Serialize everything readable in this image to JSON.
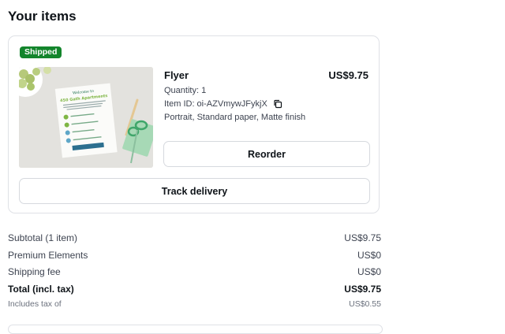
{
  "page": {
    "title": "Your items"
  },
  "order": {
    "status_badge": "Shipped",
    "status_color": "#13852c",
    "product": {
      "name": "Flyer",
      "price": "US$9.75",
      "quantity_text": "Quantity: 1",
      "item_id_text": "Item ID: oi-AZVmywJFykjX",
      "options_text": "Portrait, Standard paper, Matte finish"
    },
    "thumbnail": {
      "flyer_heading": "Welcome to",
      "flyer_title": "450 Gath Apartments"
    },
    "reorder_label": "Reorder",
    "track_label": "Track delivery"
  },
  "summary": {
    "subtotal_label": "Subtotal (1 item)",
    "subtotal_value": "US$9.75",
    "premium_label": "Premium Elements",
    "premium_value": "US$0",
    "shipping_label": "Shipping fee",
    "shipping_value": "US$0",
    "total_label": "Total (incl. tax)",
    "total_value": "US$9.75",
    "tax_label": "Includes tax of",
    "tax_value": "US$0.55"
  },
  "icons": {
    "copy": "copy-icon"
  }
}
